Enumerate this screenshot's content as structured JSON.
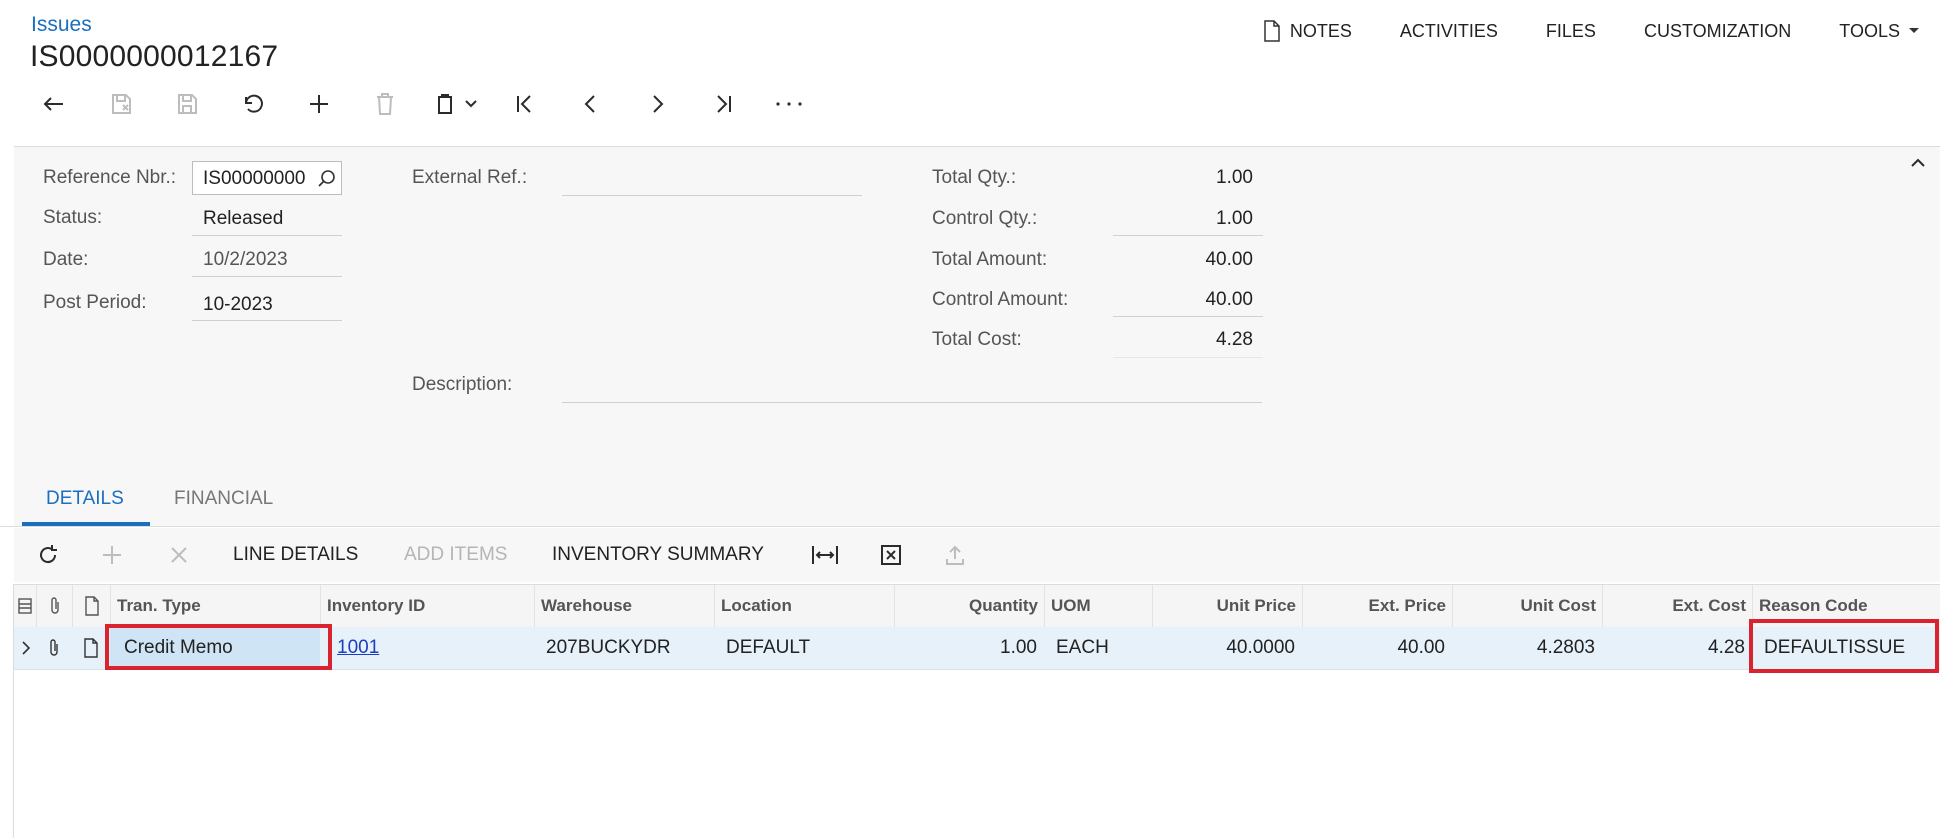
{
  "breadcrumb": "Issues",
  "page_title": "IS0000000012167",
  "topnav": {
    "notes": "NOTES",
    "activities": "ACTIVITIES",
    "files": "FILES",
    "customization": "CUSTOMIZATION",
    "tools": "TOOLS"
  },
  "toolbar": {
    "icons": [
      "undo-back-icon",
      "cancel-save-icon",
      "save-icon",
      "undo-icon",
      "add-icon",
      "delete-icon",
      "clipboard-icon",
      "first-record-icon",
      "previous-record-icon",
      "next-record-icon",
      "last-record-icon",
      "more-icon"
    ]
  },
  "form": {
    "reference_label": "Reference Nbr.:",
    "reference_value": "IS00000000",
    "status_label": "Status:",
    "status_value": "Released",
    "date_label": "Date:",
    "date_value": "10/2/2023",
    "post_period_label": "Post Period:",
    "post_period_value": "10-2023",
    "external_ref_label": "External Ref.:",
    "external_ref_value": "",
    "description_label": "Description:",
    "description_value": "",
    "total_qty_label": "Total Qty.:",
    "total_qty_value": "1.00",
    "control_qty_label": "Control Qty.:",
    "control_qty_value": "1.00",
    "total_amount_label": "Total Amount:",
    "total_amount_value": "40.00",
    "control_amount_label": "Control Amount:",
    "control_amount_value": "40.00",
    "total_cost_label": "Total Cost:",
    "total_cost_value": "4.28"
  },
  "tabs": {
    "details": "DETAILS",
    "financial": "FINANCIAL",
    "active": "details"
  },
  "grid_toolbar": {
    "line_details": "LINE DETAILS",
    "add_items": "ADD ITEMS",
    "inventory_summary": "INVENTORY SUMMARY"
  },
  "grid": {
    "columns": {
      "tran_type": "Tran. Type",
      "inventory_id": "Inventory ID",
      "warehouse": "Warehouse",
      "location": "Location",
      "quantity": "Quantity",
      "uom": "UOM",
      "unit_price": "Unit Price",
      "ext_price": "Ext. Price",
      "unit_cost": "Unit Cost",
      "ext_cost": "Ext. Cost",
      "reason_code": "Reason Code"
    },
    "rows": [
      {
        "tran_type": "Credit Memo",
        "inventory_id": "1001",
        "warehouse": "207BUCKYDR",
        "location": "DEFAULT",
        "quantity": "1.00",
        "uom": "EACH",
        "unit_price": "40.0000",
        "ext_price": "40.00",
        "unit_cost": "4.2803",
        "ext_cost": "4.28",
        "reason_code": "DEFAULTISSUE"
      }
    ]
  },
  "colors": {
    "link": "#1a6fbf",
    "highlight": "#d9232e",
    "selected_row": "#e6f1fa"
  }
}
